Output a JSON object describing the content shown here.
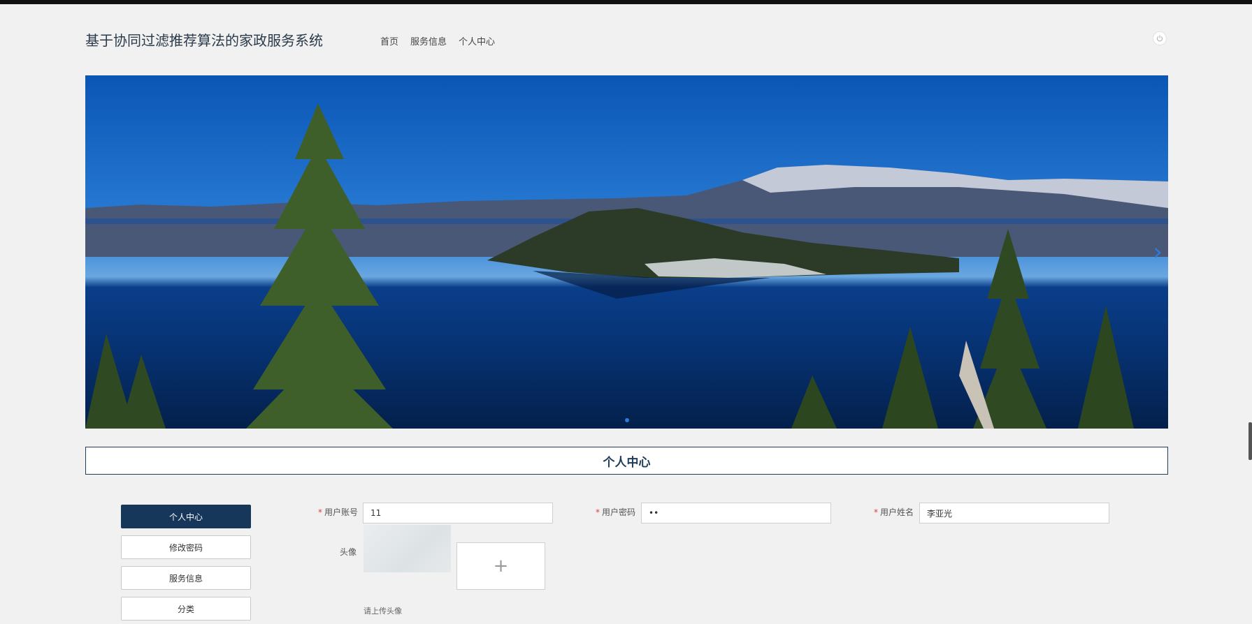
{
  "site": {
    "title": "基于协同过滤推荐算法的家政服务系统"
  },
  "nav": {
    "items": [
      "首页",
      "服务信息",
      "个人中心"
    ]
  },
  "header": {
    "power_icon": "power-icon"
  },
  "banner": {
    "next_icon": "chevron-right-icon"
  },
  "section": {
    "title": "个人中心"
  },
  "sidebar": {
    "items": [
      {
        "label": "个人中心",
        "active": true
      },
      {
        "label": "修改密码",
        "active": false
      },
      {
        "label": "服务信息",
        "active": false
      },
      {
        "label": "分类",
        "active": false
      }
    ]
  },
  "form": {
    "account": {
      "label": "用户账号",
      "value": "11"
    },
    "password": {
      "label": "用户密码",
      "value": "••"
    },
    "name": {
      "label": "用户姓名",
      "value": "李亚光"
    },
    "avatar": {
      "label": "头像",
      "upload_symbol": "+",
      "hint": "请上传头像"
    }
  },
  "colors": {
    "primary": "#16365a",
    "required": "#e23c3c",
    "background": "#f1f1f1"
  }
}
